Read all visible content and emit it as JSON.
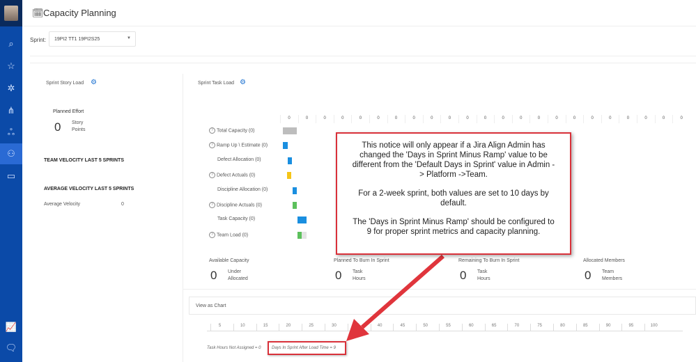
{
  "header": {
    "title": "Capacity Planning"
  },
  "sprint": {
    "label": "Sprint:",
    "value": "19PI2 TT1 19PI2S25"
  },
  "story_load": {
    "title": "Sprint Story Load",
    "planned_label": "Planned Effort",
    "planned_value": "0",
    "planned_unit_1": "Story",
    "planned_unit_2": "Points",
    "team_velocity": "TEAM VELOCITY LAST 5 SPRINTS",
    "avg_velocity_heading": "AVERAGE VELOCITY LAST 5 SPRINTS",
    "avg_velocity_label": "Average Velocity",
    "avg_velocity_value": "0"
  },
  "task_load": {
    "title": "Sprint Task Load",
    "top_ticks": [
      "0",
      "0",
      "0",
      "0",
      "0",
      "0",
      "0",
      "0",
      "0",
      "0",
      "0",
      "0",
      "0",
      "0",
      "0",
      "0",
      "0",
      "0",
      "0",
      "0",
      "0",
      "0",
      "0"
    ],
    "rows": [
      {
        "label": "Total Capacity (0)",
        "help": true,
        "color": "#bdbdbd"
      },
      {
        "label": "Ramp Up \\ Estimate (0)",
        "help": true,
        "color": "#1a8fe0"
      },
      {
        "label": "Defect Allocation (0)",
        "help": false,
        "color": "#1a8fe0"
      },
      {
        "label": "Defect Actuals (0)",
        "help": true,
        "color": "#f5c518"
      },
      {
        "label": "Discipline Allocation (0)",
        "help": false,
        "color": "#1a8fe0"
      },
      {
        "label": "Discipline Actuals (0)",
        "help": true,
        "color": "#5cc05c"
      },
      {
        "label": "Task Capacity (0)",
        "help": false,
        "color": "#1a8fe0"
      },
      {
        "label": "Team Load (0)",
        "help": true,
        "color": "#5cc05c"
      }
    ]
  },
  "stats": [
    {
      "label": "Available Capacity",
      "value": "0",
      "unit1": "Under",
      "unit2": "Allocated"
    },
    {
      "label": "Planned To Burn In Sprint",
      "value": "0",
      "unit1": "Task",
      "unit2": "Hours"
    },
    {
      "label": "Remaining To Burn In Sprint",
      "value": "0",
      "unit1": "Task",
      "unit2": "Hours"
    },
    {
      "label": "Allocated Members",
      "value": "0",
      "unit1": "Team",
      "unit2": "Members"
    }
  ],
  "view_as_chart": "View as Chart",
  "bottom_ticks": [
    "5",
    "10",
    "15",
    "20",
    "25",
    "30",
    "35",
    "40",
    "45",
    "50",
    "55",
    "60",
    "65",
    "70",
    "75",
    "80",
    "85",
    "90",
    "95",
    "100"
  ],
  "footer": {
    "not_assigned": "Task Hours Not Assigned = 0",
    "days_after_load": "Days In Sprint After Load Time = 9"
  },
  "callout": {
    "p1": "This notice will only appear if a Jira Align Admin has changed the 'Days in Sprint Minus Ramp' value to be different from the 'Default Days in Sprint' value in Admin -> Platform ->Team.",
    "p2": "For a 2-week sprint, both values are set to 10 days by default.",
    "p3": "The  'Days in Sprint Minus Ramp' should be configured to 9 for proper sprint metrics and capacity planning."
  },
  "colors": {
    "sidebar": "#0b4aa8",
    "callout_border": "#d9313a"
  }
}
